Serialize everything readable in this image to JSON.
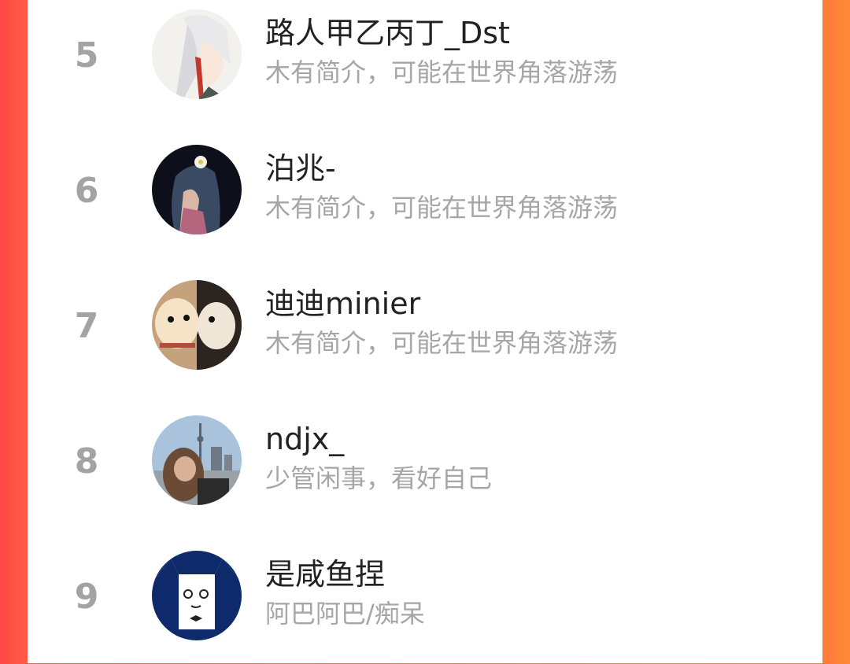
{
  "ranking": [
    {
      "rank": "5",
      "name": "路人甲乙丙丁_Dst",
      "bio": "木有简介，可能在世界角落游荡",
      "avatar_icon": "anime-white-hair-avatar-icon"
    },
    {
      "rank": "6",
      "name": "泊兆-",
      "bio": "木有简介，可能在世界角落游荡",
      "avatar_icon": "anime-girl-flower-avatar-icon"
    },
    {
      "rank": "7",
      "name": "迪迪minier",
      "bio": "木有简介，可能在世界角落游荡",
      "avatar_icon": "shiba-dogs-avatar-icon"
    },
    {
      "rank": "8",
      "name": "ndjx_",
      "bio": "少管闲事，看好自己",
      "avatar_icon": "city-selfie-avatar-icon"
    },
    {
      "rank": "9",
      "name": "是咸鱼捏",
      "bio": "阿巴阿巴/痴呆",
      "avatar_icon": "cartoon-cat-avatar-icon"
    }
  ],
  "colors": {
    "background_left": "#ff4a45",
    "background_right": "#ff8a36",
    "rank": "#a3a3a3",
    "name": "#222222",
    "bio": "#a6a6a6"
  }
}
